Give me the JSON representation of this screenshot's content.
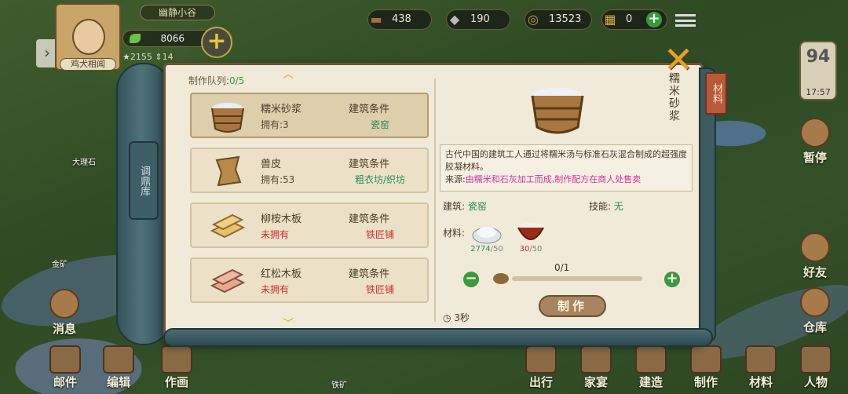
{
  "player": {
    "valley": "幽静小谷",
    "name": "鸡犬相闻",
    "gold": "8066",
    "stat1": "2155",
    "stat2": "14"
  },
  "resources": [
    {
      "icon": "wood-icon",
      "value": "438"
    },
    {
      "icon": "stone-icon",
      "value": "190"
    },
    {
      "icon": "copper-coin-icon",
      "value": "13523"
    },
    {
      "icon": "ticket-icon",
      "value": "0"
    }
  ],
  "clock": {
    "day": "94",
    "time": "17:57"
  },
  "map_labels": {
    "marble": "大理石",
    "gold_mine": "金矿",
    "iron_mine": "铁矿"
  },
  "side": {
    "pause": "暂停",
    "friends": "好友",
    "warehouse": "仓库",
    "messages": "消息"
  },
  "bottom_nav": [
    "邮件",
    "编辑",
    "作画",
    "出行",
    "家宴",
    "建造",
    "制作",
    "材料",
    "人物"
  ],
  "panel": {
    "roll_label": "调鼎库",
    "queue_label": "制作队列:",
    "queue_value": "0/5",
    "tab_material": "材料",
    "items": [
      {
        "name": "糯米砂浆",
        "own": "拥有:3",
        "cond": "建筑条件",
        "cond_value": "瓷窑",
        "owned": true
      },
      {
        "name": "兽皮",
        "own": "拥有:53",
        "cond": "建筑条件",
        "cond_value": "粗衣坊/织坊",
        "owned": true
      },
      {
        "name": "柳桉木板",
        "own": "未拥有",
        "cond": "建筑条件",
        "cond_value": "铁匠铺",
        "owned": false
      },
      {
        "name": "红松木板",
        "own": "未拥有",
        "cond": "建筑条件",
        "cond_value": "铁匠铺",
        "owned": false
      }
    ],
    "detail": {
      "title": "糯米砂浆",
      "desc": "古代中国的建筑工人通过将糯米汤与标准石灰混合制成的超强度胶凝材料。",
      "source_label": "来源:",
      "source_value": "由糯米和石灰加工而成,制作配方在商人处售卖",
      "building_label": "建筑:",
      "building_value": "瓷窑",
      "skill_label": "技能:",
      "skill_value": "无",
      "material_label": "材料:",
      "materials": [
        {
          "icon": "lime-icon",
          "have": "2774",
          "need": "/50",
          "ok": true
        },
        {
          "icon": "rice-bowl-icon",
          "have": "30",
          "need": "/50",
          "ok": false
        }
      ],
      "qty": "0/1",
      "make_label": "制作",
      "time": "3秒"
    }
  }
}
